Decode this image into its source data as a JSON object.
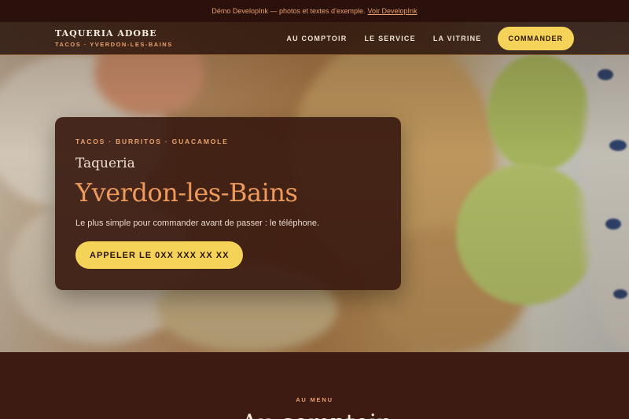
{
  "demo_bar": {
    "text": "Démo DevelopInk — photos et textes d’exemple.",
    "link": "Voir DevelopInk"
  },
  "nav": {
    "brand_name": "TAQUERIA ADOBE",
    "brand_sub": "TACOS · YVERDON-LES-BAINS",
    "links": [
      "AU COMPTOIR",
      "LE SERVICE",
      "LA VITRINE"
    ],
    "cta": "COMMANDER"
  },
  "hero": {
    "kicker": "TACOS · BURRITOS · GUACAMOLE",
    "pre_title": "Taqueria",
    "title": "Yverdon-les-Bains",
    "description": "Le plus simple pour commander avant de passer : le téléphone.",
    "cta": "APPELER LE 0XX XXX XX XX"
  },
  "menu": {
    "kicker": "AU MENU",
    "title": "Au comptoir"
  },
  "colors": {
    "accent": "#f5d358",
    "brand_orange": "#ee9a5c",
    "background": "#3d1a12"
  }
}
